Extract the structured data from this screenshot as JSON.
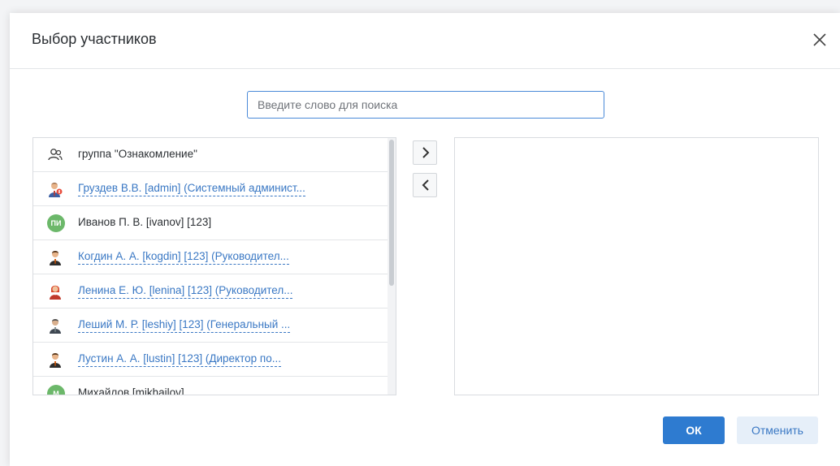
{
  "dialog": {
    "title": "Выбор участников"
  },
  "search": {
    "placeholder": "Введите слово для поиска",
    "value": ""
  },
  "list": {
    "items": [
      {
        "label": "группа \"Ознакомление\"",
        "icon": "group-icon",
        "link": false
      },
      {
        "label": "Груздев В.В. [admin] (Системный админист...",
        "icon": "admin-avatar-icon",
        "link": true
      },
      {
        "label": "Иванов П. В. [ivanov] [123]",
        "icon": "initials-avatar",
        "initials": "ПИ",
        "link": false
      },
      {
        "label": "Когдин А. А. [kogdin] [123] (Руководител...",
        "icon": "male-user-icon",
        "link": true
      },
      {
        "label": "Ленина Е. Ю. [lenina] [123] (Руководител...",
        "icon": "female-user-icon",
        "link": true
      },
      {
        "label": "Леший М. Р. [leshiy] [123] (Генеральный ...",
        "icon": "manager-user-icon",
        "link": true
      },
      {
        "label": "Лустин А. А. [lustin] [123] (Директор по...",
        "icon": "male-user-icon",
        "link": true
      },
      {
        "label": "Михайлов [mikhailov]",
        "icon": "initials-avatar",
        "initials": "М",
        "link": false
      }
    ]
  },
  "buttons": {
    "ok": "ОК",
    "cancel": "Отменить"
  },
  "colors": {
    "accent": "#2e7bd0",
    "link": "#3a78c4",
    "avatar_green": "#6cb86a"
  }
}
